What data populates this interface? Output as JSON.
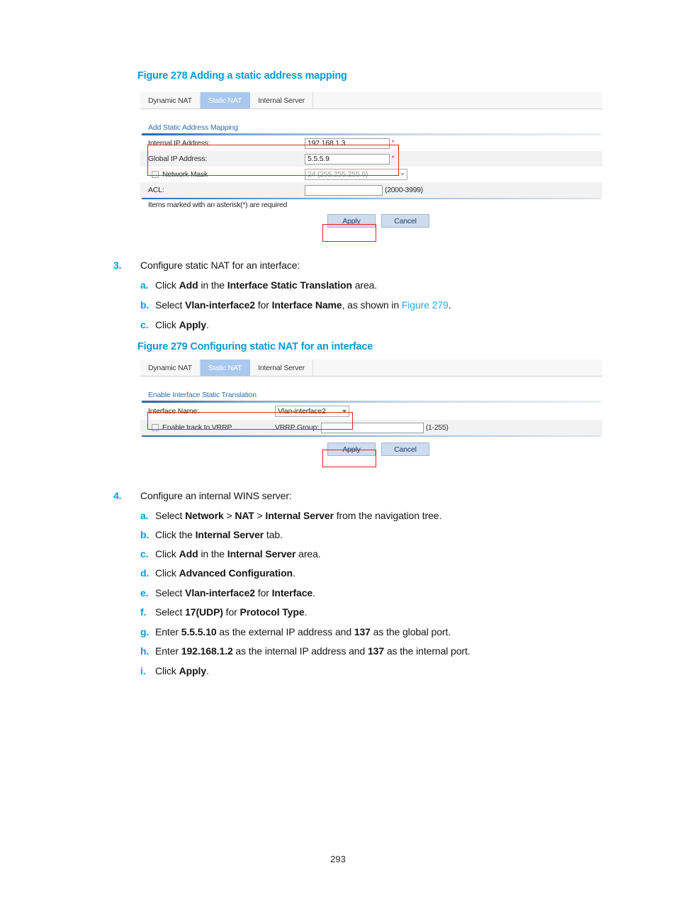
{
  "figure278": {
    "caption": "Figure 278 Adding a static address mapping",
    "tabs": [
      {
        "label": "Dynamic NAT",
        "active": false
      },
      {
        "label": "Static NAT",
        "active": true
      },
      {
        "label": "Internal Server",
        "active": false
      }
    ],
    "section_label": "Add Static Address Mapping",
    "fields": {
      "internal_ip_label": "Internal IP Address:",
      "internal_ip_value": "192.168.1.3",
      "global_ip_label": "Global IP Address:",
      "global_ip_value": "5.5.5.9",
      "network_mask_label": "Network Mask",
      "network_mask_value": "24 (255.255.255.0)",
      "acl_label": "ACL:",
      "acl_value": "",
      "acl_hint": "(2000-3999)",
      "required_marker": "*"
    },
    "note": "Items marked with an asterisk(*) are required",
    "buttons": {
      "apply": "Apply",
      "cancel": "Cancel"
    }
  },
  "figure279": {
    "caption": "Figure 279 Configuring static NAT for an interface",
    "tabs": [
      {
        "label": "Dynamic NAT",
        "active": false
      },
      {
        "label": "Static NAT",
        "active": true
      },
      {
        "label": "Internal Server",
        "active": false
      }
    ],
    "section_label": "Enable Interface Static Translation",
    "fields": {
      "interface_name_label": "Interface Name:",
      "interface_name_value": "Vlan-interface2",
      "track_vrrp_label": "Enable track to VRRP",
      "vrrp_group_label": "VRRP Group:",
      "vrrp_group_value": "",
      "vrrp_group_hint": "(1-255)"
    },
    "buttons": {
      "apply": "Apply",
      "cancel": "Cancel"
    }
  },
  "step3": {
    "number": "3.",
    "title": "Configure static NAT for an interface:",
    "items": [
      {
        "letter": "a.",
        "html": "Click <b>Add</b> in the <b>Interface Static Translation</b> area."
      },
      {
        "letter": "b.",
        "html": "Select <b>Vlan-interface2</b> for <b>Interface Name</b>, as shown in <span class=\"xref\">Figure 279</span>."
      },
      {
        "letter": "c.",
        "html": "Click <b>Apply</b>."
      }
    ]
  },
  "step4": {
    "number": "4.",
    "title": "Configure an internal WINS server:",
    "items": [
      {
        "letter": "a.",
        "html": "Select <b>Network</b> &gt; <b>NAT</b> &gt; <b>Internal Server</b> from the navigation tree."
      },
      {
        "letter": "b.",
        "html": "Click the <b>Internal Server</b> tab."
      },
      {
        "letter": "c.",
        "html": "Click <b>Add</b> in the <b>Internal Server</b> area."
      },
      {
        "letter": "d.",
        "html": "Click <b>Advanced Configuration</b>."
      },
      {
        "letter": "e.",
        "html": "Select <b>Vlan-interface2</b> for <b>Interface</b>."
      },
      {
        "letter": "f.",
        "html": "Select <b>17(UDP)</b> for <b>Protocol Type</b>."
      },
      {
        "letter": "g.",
        "html": "Enter <b>5.5.5.10</b> as the external IP address and <b>137</b> as the global port."
      },
      {
        "letter": "h.",
        "html": "Enter <b>192.168.1.2</b> as the internal IP address and <b>137</b> as the internal port."
      },
      {
        "letter": "i.",
        "html": "Click <b>Apply</b>."
      }
    ]
  },
  "page_number": "293",
  "colors": {
    "heading_blue": "#0b9ad6",
    "xref_blue": "#2aa8e0",
    "active_tab": "#a8c8ef",
    "highlight_red": "#e2231a",
    "section_blue": "#2a6fb5",
    "button_blue": "#cfdcf0"
  }
}
